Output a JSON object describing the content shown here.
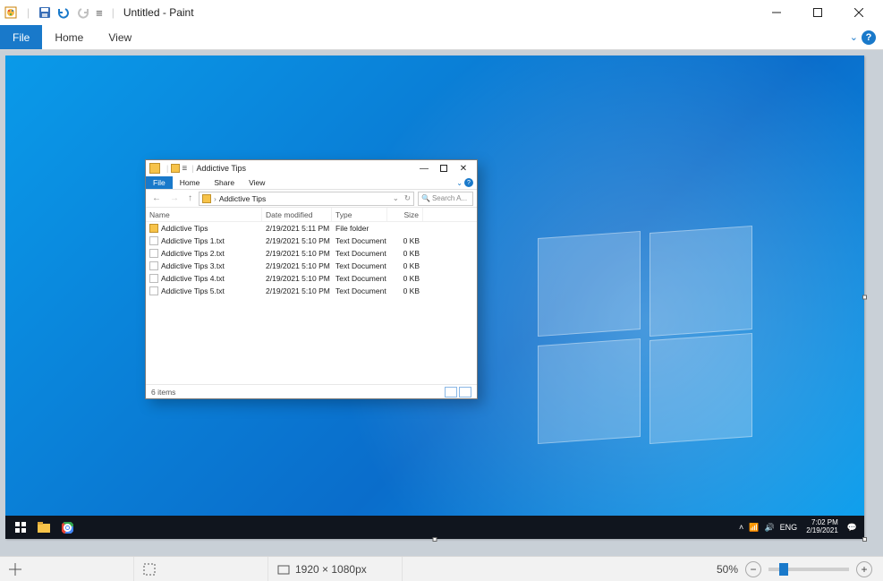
{
  "paint": {
    "title": "Untitled - Paint",
    "tabs": {
      "file": "File",
      "home": "Home",
      "view": "View"
    },
    "status": {
      "canvas_size": "1920 × 1080px",
      "zoom": "50%"
    }
  },
  "desktop": {
    "taskbar": {
      "lang": "ENG",
      "time": "7:02 PM",
      "date": "2/19/2021"
    }
  },
  "explorer": {
    "title": "Addictive Tips",
    "tabs": {
      "file": "File",
      "home": "Home",
      "share": "Share",
      "view": "View"
    },
    "path": "Addictive Tips",
    "search_placeholder": "Search A...",
    "columns": {
      "name": "Name",
      "date": "Date modified",
      "type": "Type",
      "size": "Size"
    },
    "rows": [
      {
        "icon": "folder",
        "name": "Addictive Tips",
        "date": "2/19/2021 5:11 PM",
        "type": "File folder",
        "size": ""
      },
      {
        "icon": "txt",
        "name": "Addictive Tips 1.txt",
        "date": "2/19/2021 5:10 PM",
        "type": "Text Document",
        "size": "0 KB"
      },
      {
        "icon": "txt",
        "name": "Addictive Tips 2.txt",
        "date": "2/19/2021 5:10 PM",
        "type": "Text Document",
        "size": "0 KB"
      },
      {
        "icon": "txt",
        "name": "Addictive Tips 3.txt",
        "date": "2/19/2021 5:10 PM",
        "type": "Text Document",
        "size": "0 KB"
      },
      {
        "icon": "txt",
        "name": "Addictive Tips 4.txt",
        "date": "2/19/2021 5:10 PM",
        "type": "Text Document",
        "size": "0 KB"
      },
      {
        "icon": "txt",
        "name": "Addictive Tips 5.txt",
        "date": "2/19/2021 5:10 PM",
        "type": "Text Document",
        "size": "0 KB"
      }
    ],
    "status": "6 items"
  }
}
